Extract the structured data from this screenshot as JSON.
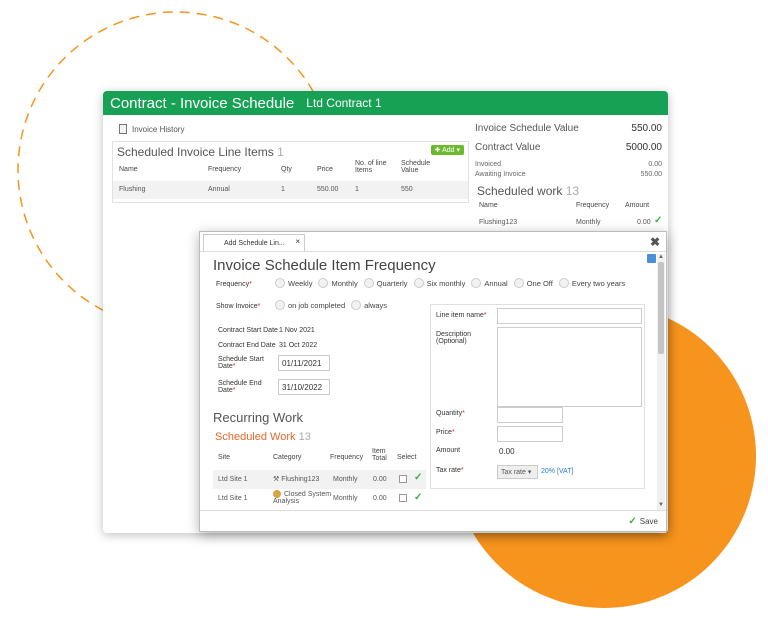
{
  "decor": {
    "orange": "#f7941d",
    "dashed": "#f7941d"
  },
  "back": {
    "title": "Contract - Invoice Schedule",
    "subtitle": "Ltd Contract 1",
    "history_label": "Invoice History",
    "sil_title": "Scheduled Invoice Line Items",
    "sil_count": "1",
    "add_label": "Add",
    "sil_columns": [
      "Name",
      "Frequency",
      "Qty",
      "Price",
      "No. of line Items",
      "Schedule Value"
    ],
    "sil_row": [
      "Flushing",
      "Annual",
      "1",
      "550.00",
      "1",
      "550"
    ],
    "isv_label": "Invoice Schedule Value",
    "isv_value": "550.00",
    "cv_label": "Contract Value",
    "cv_value": "5000.00",
    "invoiced_label": "Invoiced",
    "invoiced_value": "0.00",
    "awaiting_label": "Awaiting Invoice",
    "awaiting_value": "550.00",
    "sw_title": "Scheduled work",
    "sw_count": "13",
    "sw_columns": [
      "Name",
      "Frequency",
      "Amount"
    ],
    "sw_row": [
      "Flushing123",
      "Monthly",
      "0.00"
    ]
  },
  "dialog": {
    "tab_label": "Add Schedule Lin...",
    "tab_close": "×",
    "close": "✖",
    "heading": "Invoice Schedule Item Frequency",
    "frequency_label": "Frequency",
    "frequency_options": [
      "Weekly",
      "Monthly",
      "Quarterly",
      "Six monthly",
      "Annual",
      "One Off",
      "Every two years"
    ],
    "show_invoice_label": "Show Invoice",
    "show_invoice_options": [
      "on job completed",
      "always"
    ],
    "contract_start_label": "Contract Start Date",
    "contract_start_value": "1 Nov 2021",
    "contract_end_label": "Contract End Date",
    "contract_end_value": "31 Oct 2022",
    "schedule_start_label": "Schedule Start Date",
    "schedule_start_value": "01/11/2021",
    "schedule_end_label": "Schedule End Date",
    "schedule_end_value": "31/10/2022",
    "recurring_heading": "Recurring Work",
    "scheduled_work": "Scheduled Work",
    "scheduled_work_count": "13",
    "table_columns": [
      "Site",
      "Category",
      "Frequency",
      "Item Total",
      "Select"
    ],
    "rows": [
      {
        "site": "Ltd Site 1",
        "category": "Flushing123",
        "frequency": "Monthly",
        "total": "0.00"
      },
      {
        "site": "Ltd Site 1",
        "category": "Closed System Analysis",
        "frequency": "Monthly",
        "total": "0.00"
      }
    ],
    "line_item_name_label": "Line item name",
    "description_label": "Description (Optional)",
    "quantity_label": "Quantity",
    "price_label": "Price",
    "amount_label": "Amount",
    "amount_value": "0.00",
    "tax_rate_label": "Tax rate",
    "tax_select": "Tax rate",
    "tax_value": "20% [VAT]",
    "save_label": "Save"
  }
}
